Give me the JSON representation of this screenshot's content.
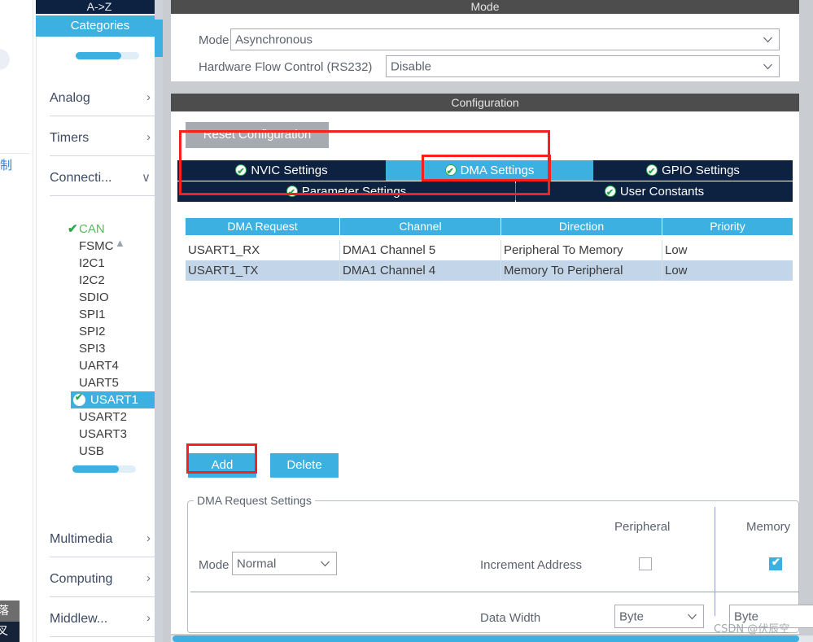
{
  "left_edge": {
    "cn_fragment": "制",
    "gray_box_text": "落",
    "dark_box_text": "叉"
  },
  "sidebar": {
    "tab_az": "A->Z",
    "tab_categories": "Categories",
    "groups_top": [
      {
        "label": "Analog",
        "chevron": "chevron-right-icon",
        "glyph": "›"
      },
      {
        "label": "Timers",
        "chevron": "chevron-right-icon",
        "glyph": "›"
      },
      {
        "label": "Connecti...",
        "chevron": "chevron-down-icon",
        "glyph": "∨"
      }
    ],
    "scroll_up_glyph": "▲",
    "peripherals": [
      {
        "label": "CAN",
        "state": "configured",
        "selected": false
      },
      {
        "label": "FSMC",
        "state": "none",
        "selected": false
      },
      {
        "label": "I2C1",
        "state": "none",
        "selected": false
      },
      {
        "label": "I2C2",
        "state": "none",
        "selected": false
      },
      {
        "label": "SDIO",
        "state": "none",
        "selected": false
      },
      {
        "label": "SPI1",
        "state": "none",
        "selected": false
      },
      {
        "label": "SPI2",
        "state": "none",
        "selected": false
      },
      {
        "label": "SPI3",
        "state": "none",
        "selected": false
      },
      {
        "label": "UART4",
        "state": "none",
        "selected": false
      },
      {
        "label": "UART5",
        "state": "none",
        "selected": false
      },
      {
        "label": "USART1",
        "state": "configured",
        "selected": true
      },
      {
        "label": "USART2",
        "state": "none",
        "selected": false
      },
      {
        "label": "USART3",
        "state": "none",
        "selected": false
      },
      {
        "label": "USB",
        "state": "none",
        "selected": false
      }
    ],
    "groups_bottom": [
      {
        "label": "Multimedia",
        "chevron": "chevron-right-icon",
        "glyph": "›"
      },
      {
        "label": "Computing",
        "chevron": "chevron-right-icon",
        "glyph": "›"
      },
      {
        "label": "Middlew...",
        "chevron": "chevron-right-icon",
        "glyph": "›"
      }
    ]
  },
  "mode_section": {
    "title": "Mode",
    "fields": [
      {
        "label": "Mode",
        "value": "Asynchronous"
      },
      {
        "label": "Hardware Flow Control (RS232)",
        "value": "Disable"
      }
    ]
  },
  "configuration_section": {
    "title": "Configuration",
    "reset_button": "Reset Configuration",
    "tabs_row1": [
      {
        "label": "NVIC Settings",
        "active": false
      },
      {
        "label": "DMA Settings",
        "active": true
      },
      {
        "label": "GPIO Settings",
        "active": false
      }
    ],
    "tabs_row2": [
      {
        "label": "Parameter Settings",
        "active": false
      },
      {
        "label": "User Constants",
        "active": false
      }
    ]
  },
  "dma_table": {
    "headers": [
      "DMA Request",
      "Channel",
      "Direction",
      "Priority"
    ],
    "rows": [
      {
        "request": "USART1_RX",
        "channel": "DMA1 Channel 5",
        "direction": "Peripheral To Memory",
        "priority": "Low",
        "selected": false
      },
      {
        "request": "USART1_TX",
        "channel": "DMA1 Channel 4",
        "direction": "Memory To Peripheral",
        "priority": "Low",
        "selected": true
      }
    ]
  },
  "actions": {
    "add": "Add",
    "delete": "Delete"
  },
  "request_settings": {
    "legend": "DMA Request Settings",
    "col_peripheral": "Peripheral",
    "col_memory": "Memory",
    "mode_label": "Mode",
    "mode_value": "Normal",
    "increment_address_label": "Increment Address",
    "increment_peripheral_checked": false,
    "increment_memory_checked": true,
    "data_width_label": "Data Width",
    "data_width_peripheral": "Byte",
    "data_width_memory": "Byte"
  },
  "watermark": "CSDN @伏辰空",
  "colors": {
    "accent_blue": "#3cb0e0",
    "navy": "#0d2141",
    "header_gray": "#4d4d4d",
    "highlight_red": "#f52020",
    "row_selected": "#c3d5e8",
    "check_green": "#2aa84a"
  }
}
